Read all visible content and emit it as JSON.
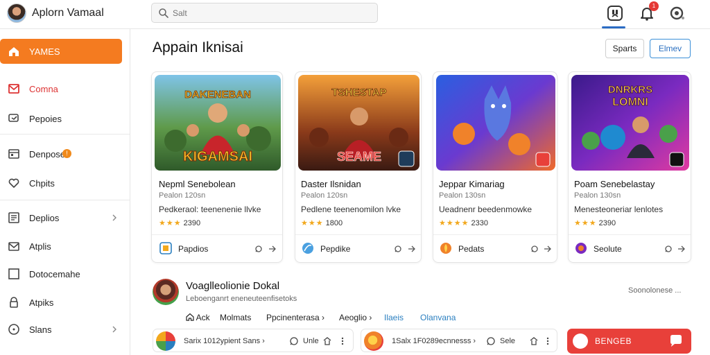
{
  "header": {
    "app_title": "Aplorn Vamaal",
    "search_placeholder": "Salt",
    "notification_count": "1"
  },
  "sidebar": {
    "items": [
      {
        "label": "YAMES",
        "icon": "home-icon",
        "active": true
      },
      {
        "label": "Comna",
        "icon": "mail-icon"
      },
      {
        "label": "Pepoies",
        "icon": "chat-icon"
      },
      {
        "label": "Denpose",
        "icon": "calendar-icon",
        "badge": "!"
      },
      {
        "label": "Chpits",
        "icon": "heart-icon"
      },
      {
        "label": "Deplios",
        "icon": "document-icon"
      },
      {
        "label": "Atplis",
        "icon": "envelope-icon"
      },
      {
        "label": "Dotocemahe",
        "icon": "square-icon"
      },
      {
        "label": "Atpiks",
        "icon": "lock-icon"
      },
      {
        "label": "Slans",
        "icon": "clock-icon"
      }
    ]
  },
  "main": {
    "title": "Appain Iknisai",
    "buttons": {
      "sports": "Sparts",
      "elmov": "Elmev"
    },
    "cards": [
      {
        "art_title": "DAKENEBAN",
        "art_subtitle": "KIGAMSAI",
        "title": "Nepml Senebolean",
        "subtitle": "Pealon 120sn",
        "description": "Pedkeraol: teenenenie llvke",
        "rating_text": "2390",
        "stars": 3,
        "footer_label": "Papdios",
        "footer_icon": "page-icon"
      },
      {
        "art_title": "TSHESTAP",
        "art_subtitle": "SEAME",
        "title": "Daster Ilsnidan",
        "subtitle": "Pealon 120sn",
        "description": "Pedlene teenenomilon lvke",
        "rating_text": "1800",
        "stars": 3,
        "footer_label": "Pepdike",
        "footer_icon": "leaf-icon"
      },
      {
        "art_title": "",
        "art_subtitle": "",
        "title": "Jeppar Kimariag",
        "subtitle": "Pealon 130sn",
        "description": "Ueadnenr beedenmowke",
        "rating_text": "2330",
        "stars": 4,
        "footer_label": "Pedats",
        "footer_icon": "flame-icon"
      },
      {
        "art_title": "DNRKRS",
        "art_subtitle": "LOMNI",
        "title": "Poam Senebelastay",
        "subtitle": "Pealon 130sn",
        "description": "Menesteoneriar lenlotes",
        "rating_text": "2390",
        "stars": 3,
        "footer_label": "Seolute",
        "footer_icon": "globe-icon"
      }
    ]
  },
  "profile": {
    "name": "Voaglleolionie Dokal",
    "subtitle": "Leboenganrt eneneuteenfisetoks",
    "meta": "Soonolonese ..."
  },
  "tags": [
    {
      "label": "Ack",
      "icon": "home-icon"
    },
    {
      "label": "Molmats"
    },
    {
      "label": "Ppcinenterasa ›"
    },
    {
      "label": "Aeoglio ›"
    },
    {
      "label": "Ilaeis",
      "blue": true
    },
    {
      "label": "Olanvana",
      "blue": true
    }
  ],
  "bottom": {
    "card1": {
      "text": "Sarix 1012ypient Sans ›",
      "action": "Unle"
    },
    "card2": {
      "text": "1Salx 1F0289ecnnesss ›",
      "action": "Sele"
    },
    "cta_label": "BENGEB"
  },
  "colors": {
    "accent": "#f47b20",
    "blue": "#2a7fc0",
    "cta": "#e8403a",
    "star": "#f2a81d"
  }
}
